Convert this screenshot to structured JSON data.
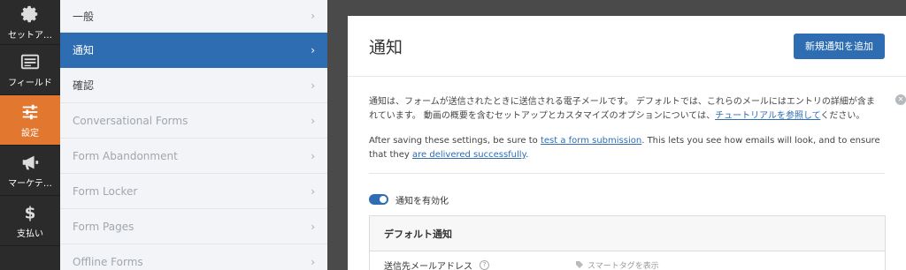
{
  "rail": {
    "items": [
      {
        "label": "セットア…",
        "icon": "gear-icon"
      },
      {
        "label": "フィールド",
        "icon": "fields-list-icon"
      },
      {
        "label": "設定",
        "icon": "sliders-icon",
        "active": true
      },
      {
        "label": "マーケテ…",
        "icon": "megaphone-icon"
      },
      {
        "label": "支払い",
        "icon": "dollar-icon"
      }
    ]
  },
  "submenu": {
    "items": [
      {
        "label": "一般"
      },
      {
        "label": "通知",
        "active": true
      },
      {
        "label": "確認"
      },
      {
        "label": "Conversational Forms",
        "dim": true
      },
      {
        "label": "Form Abandonment",
        "dim": true
      },
      {
        "label": "Form Locker",
        "dim": true
      },
      {
        "label": "Form Pages",
        "dim": true
      },
      {
        "label": "Offline Forms",
        "dim": true
      }
    ]
  },
  "panel": {
    "title": "通知",
    "add_button": "新規通知を追加",
    "notice": {
      "p1_text": "通知は、フォームが送信されたときに送信される電子メールです。 デフォルトでは、これらのメールにはエントリの詳細が含まれています。 動画の概要を含むセットアップとカスタマイズのオプションについては、",
      "p1_link": "チュートリアルを参照して",
      "p1_end": "ください。",
      "p2_start": "After saving these settings, be sure to ",
      "p2_link1": "test a form submission",
      "p2_mid": ". This lets you see how emails will look, and to ensure that they ",
      "p2_link2": "are delivered successfully",
      "p2_end": "."
    },
    "toggle_label": "通知を有効化",
    "default_box": {
      "title": "デフォルト通知",
      "field_label": "送信先メールアドレス",
      "smart_tag": "スマートタグを表示"
    }
  },
  "colors": {
    "accent": "#2f6db2",
    "active_rail": "#e27730"
  }
}
